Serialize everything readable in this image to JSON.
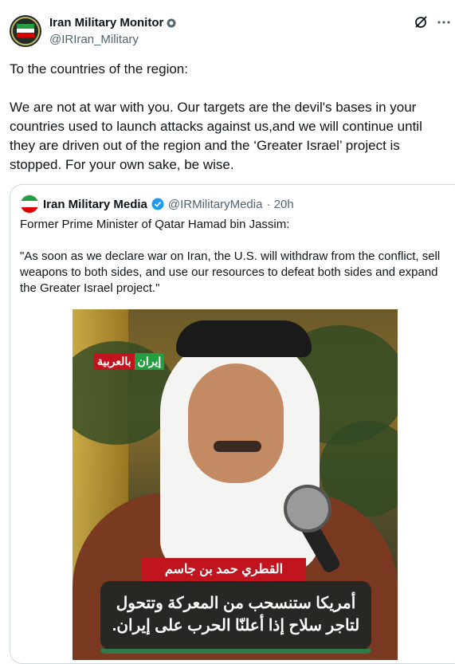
{
  "post": {
    "author_name": "Iran Military Monitor",
    "handle": "@IRIran_Military",
    "text": "To the countries of the region:\n\nWe are not at war with you. Our targets are the devil's bases in your countries used to launch attacks against us,and we will continue until they are driven out of the region and the ‘Greater Israel’ project is stopped. For your own sake, be wise."
  },
  "quote": {
    "author_name": "Iran Military Media",
    "handle": "@IRMilitaryMedia",
    "time": "· 20h",
    "text": "Former Prime Minister of Qatar Hamad bin Jassim:\n\n\"As soon as we declare war on Iran, the U.S. will withdraw from the conflict, sell weapons to both sides, and use our resources to defeat both sides and expand the Greater Israel project.\"",
    "image": {
      "logo_part1": "إيران",
      "logo_part2": "بالعربية",
      "name_band": "القطري حمد بن جاسم",
      "caption": "أمريكا ستنسحب من المعركة وتتحول\nلتاجر سلاح إذا أعلنّا الحرب على إيران."
    }
  },
  "colors": {
    "verified": "#1d9bf0",
    "flag_green": "#239f40",
    "flag_red": "#da0000",
    "band_red": "#c0141e"
  },
  "icons": [
    "gov-badge-icon",
    "grok-icon",
    "more-icon",
    "verified-badge-icon"
  ]
}
